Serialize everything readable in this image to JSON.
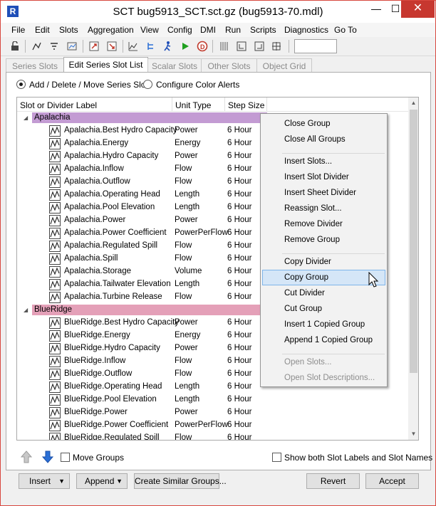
{
  "window": {
    "title": "SCT bug5913_SCT.sct.gz (bug5913-70.mdl)",
    "app_icon_letter": "R",
    "min_glyph": "—",
    "max_glyph": "☐",
    "close_glyph": "✕"
  },
  "menubar": [
    "File",
    "Edit",
    "Slots",
    "Aggregation",
    "View",
    "Config",
    "DMI",
    "Run",
    "Scripts",
    "Diagnostics",
    "Go To"
  ],
  "toolbar": {
    "icons": [
      "lock-icon",
      "slot-link-icon",
      "filter-icon",
      "plot-icon",
      "open-slot-icon",
      "clear-icon",
      "chart-icon",
      "tree-icon",
      "run-icon",
      "play-icon",
      "stop-icon",
      "grid-icon",
      "bracket-left-icon",
      "bracket-right-icon",
      "expand-icon"
    ],
    "input_value": ""
  },
  "tabs": [
    {
      "label": "Series Slots",
      "active": false
    },
    {
      "label": "Edit Series Slot List",
      "active": true
    },
    {
      "label": "Scalar Slots",
      "active": false
    },
    {
      "label": "Other Slots",
      "active": false
    },
    {
      "label": "Object Grid",
      "active": false
    }
  ],
  "mode": {
    "option1": "Add / Delete / Move Series Slot",
    "option2": "Configure Color Alerts",
    "selected": "option1"
  },
  "table": {
    "headers": [
      "Slot or Divider Label",
      "Unit Type",
      "Step Size"
    ],
    "groups": [
      {
        "name": "Apalachia",
        "color": "#c39bd3",
        "rows": [
          [
            "Apalachia.Best Hydro Capacity",
            "Power",
            "6 Hour"
          ],
          [
            "Apalachia.Energy",
            "Energy",
            "6 Hour"
          ],
          [
            "Apalachia.Hydro Capacity",
            "Power",
            "6 Hour"
          ],
          [
            "Apalachia.Inflow",
            "Flow",
            "6 Hour"
          ],
          [
            "Apalachia.Outflow",
            "Flow",
            "6 Hour"
          ],
          [
            "Apalachia.Operating Head",
            "Length",
            "6 Hour"
          ],
          [
            "Apalachia.Pool Elevation",
            "Length",
            "6 Hour"
          ],
          [
            "Apalachia.Power",
            "Power",
            "6 Hour"
          ],
          [
            "Apalachia.Power Coefficient",
            "PowerPerFlow",
            "6 Hour"
          ],
          [
            "Apalachia.Regulated Spill",
            "Flow",
            "6 Hour"
          ],
          [
            "Apalachia.Spill",
            "Flow",
            "6 Hour"
          ],
          [
            "Apalachia.Storage",
            "Volume",
            "6 Hour"
          ],
          [
            "Apalachia.Tailwater Elevation",
            "Length",
            "6 Hour"
          ],
          [
            "Apalachia.Turbine Release",
            "Flow",
            "6 Hour"
          ]
        ]
      },
      {
        "name": "BlueRidge",
        "color": "#e4a0b8",
        "rows": [
          [
            "BlueRidge.Best Hydro Capacity",
            "Power",
            "6 Hour"
          ],
          [
            "BlueRidge.Energy",
            "Energy",
            "6 Hour"
          ],
          [
            "BlueRidge.Hydro Capacity",
            "Power",
            "6 Hour"
          ],
          [
            "BlueRidge.Inflow",
            "Flow",
            "6 Hour"
          ],
          [
            "BlueRidge.Outflow",
            "Flow",
            "6 Hour"
          ],
          [
            "BlueRidge.Operating Head",
            "Length",
            "6 Hour"
          ],
          [
            "BlueRidge.Pool Elevation",
            "Length",
            "6 Hour"
          ],
          [
            "BlueRidge.Power",
            "Power",
            "6 Hour"
          ],
          [
            "BlueRidge.Power Coefficient",
            "PowerPerFlow",
            "6 Hour"
          ],
          [
            "BlueRidge.Regulated Spill",
            "Flow",
            "6 Hour"
          ]
        ]
      }
    ]
  },
  "context_menu": {
    "items": [
      {
        "label": "Close Group",
        "disabled": false
      },
      {
        "label": "Close All Groups",
        "disabled": false
      },
      {
        "sep": true
      },
      {
        "label": "Insert Slots...",
        "disabled": false
      },
      {
        "label": "Insert Slot Divider",
        "disabled": false
      },
      {
        "label": "Insert Sheet Divider",
        "disabled": false
      },
      {
        "label": "Reassign Slot...",
        "disabled": false
      },
      {
        "label": "Remove Divider",
        "disabled": false
      },
      {
        "label": "Remove Group",
        "disabled": false
      },
      {
        "sep": true
      },
      {
        "label": "Copy Divider",
        "disabled": false
      },
      {
        "label": "Copy Group",
        "disabled": false,
        "highlighted": true
      },
      {
        "label": "Cut Divider",
        "disabled": false
      },
      {
        "label": "Cut Group",
        "disabled": false
      },
      {
        "label": "Insert 1 Copied Group",
        "disabled": false
      },
      {
        "label": "Append 1 Copied Group",
        "disabled": false
      },
      {
        "sep": true
      },
      {
        "label": "Open Slots...",
        "disabled": true
      },
      {
        "label": "Open Slot Descriptions...",
        "disabled": true
      }
    ]
  },
  "controls": {
    "move_groups_label": "Move Groups",
    "show_both_label": "Show both Slot Labels and Slot Names",
    "insert_label": "Insert",
    "append_label": "Append",
    "create_similar_label": "Create Similar Groups...",
    "revert_label": "Revert",
    "accept_label": "Accept"
  },
  "colors": {
    "up_arrow": "#9a9a9a",
    "down_arrow": "#2a6fd6",
    "menu_highlight": "#d5e6f7"
  }
}
